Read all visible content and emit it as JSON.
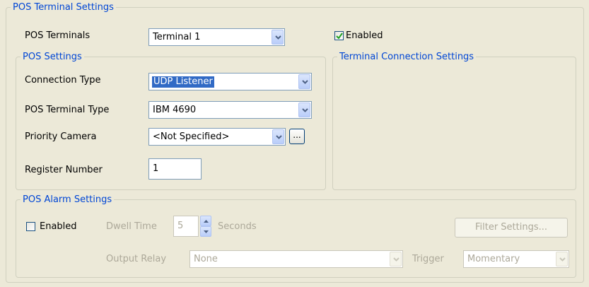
{
  "pos_terminal_settings": {
    "legend": "POS Terminal Settings",
    "pos_terminals_label": "POS Terminals",
    "pos_terminals_value": "Terminal 1",
    "enabled_label": "Enabled",
    "enabled_checked": true
  },
  "pos_settings": {
    "legend": "POS Settings",
    "connection_type_label": "Connection Type",
    "connection_type_value": "UDP Listener",
    "terminal_type_label": "POS Terminal Type",
    "terminal_type_value": "IBM 4690",
    "priority_camera_label": "Priority Camera",
    "priority_camera_value": "<Not Specified>",
    "browse_button_label": "...",
    "register_number_label": "Register Number",
    "register_number_value": "1"
  },
  "terminal_connection_settings": {
    "legend": "Terminal Connection Settings"
  },
  "pos_alarm_settings": {
    "legend": "POS Alarm Settings",
    "enabled_label": "Enabled",
    "enabled_checked": false,
    "dwell_time_label": "Dwell Time",
    "dwell_time_value": "5",
    "seconds_label": "Seconds",
    "filter_settings_label": "Filter Settings...",
    "output_relay_label": "Output Relay",
    "output_relay_value": "None",
    "trigger_label": "Trigger",
    "trigger_value": "Momentary"
  },
  "colors": {
    "background": "#ece9d8",
    "group_legend": "#0046d5",
    "selection": "#316ac5",
    "disabled_text": "#aca899"
  }
}
